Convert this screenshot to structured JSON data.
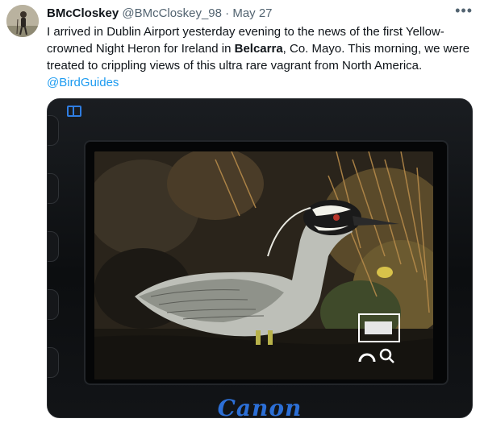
{
  "tweet": {
    "display_name": "BMcCloskey",
    "handle": "@BMcCloskey_98",
    "separator": "·",
    "date": "May 27",
    "more_icon": "more-horizontal-icon",
    "text_part1": "I arrived in Dublin Airport yesterday evening to the news of the first Yellow-crowned Night Heron for Ireland in ",
    "text_bold": "Belcarra",
    "text_part2": ", Co. Mayo. This morning, we were treated to crippling views of this ultra rare vagrant from North America. ",
    "mention": "@BirdGuides"
  },
  "media": {
    "camera_brand": "Canon",
    "screen_icons": [
      "grid-icon",
      "zoom-frame-icon",
      "magnify-icon"
    ]
  },
  "colors": {
    "link": "#1d9bf0",
    "secondary_text": "#536471",
    "brand_blue": "#2c6fd6"
  }
}
